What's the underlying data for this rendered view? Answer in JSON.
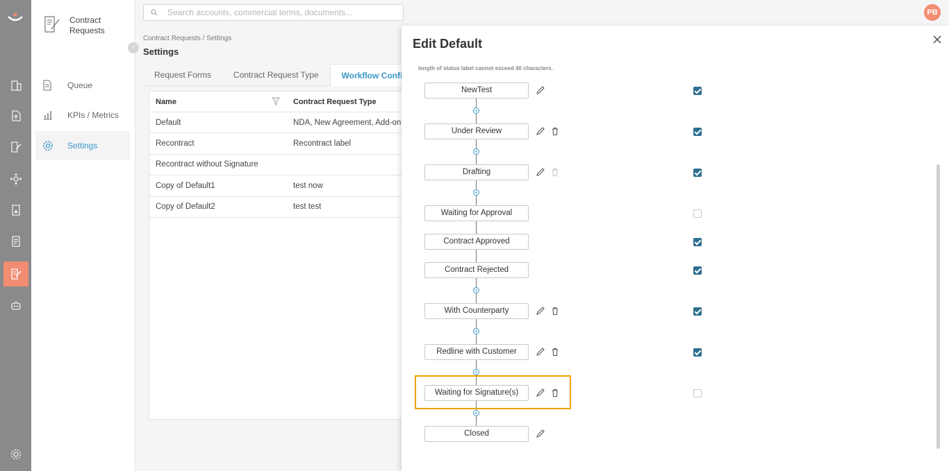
{
  "colors": {
    "accent": "#3a96c8",
    "brand": "#f28c73",
    "rail": "#8a8a8a",
    "highlight": "#f0a400"
  },
  "app": {
    "module_title": "Contract Requests",
    "avatar_initials": "PB"
  },
  "search": {
    "placeholder": "Search accounts, commercial terms, documents..."
  },
  "sidebar": {
    "items": [
      {
        "label": "Queue",
        "icon": "document-icon"
      },
      {
        "label": "KPIs / Metrics",
        "icon": "chart-icon"
      },
      {
        "label": "Settings",
        "icon": "gear-icon",
        "active": true
      }
    ]
  },
  "rail": {
    "icons": [
      "buildings-icon",
      "upload-doc-icon",
      "edit-doc-icon",
      "network-icon",
      "image-doc-icon",
      "file-doc-icon",
      "contract-request-icon",
      "robot-icon",
      "settings-icon"
    ]
  },
  "page": {
    "breadcrumb": "Contract Requests / Settings",
    "title": "Settings",
    "tabs": [
      "Request Forms",
      "Contract Request Type",
      "Workflow Configurat"
    ]
  },
  "table": {
    "headers": [
      "Name",
      "Contract Request Type"
    ],
    "rows": [
      [
        "Default",
        "NDA, New Agreement, Add-on, Re"
      ],
      [
        "Recontract",
        "Recontract label"
      ],
      [
        "Recontract without Signature",
        ""
      ],
      [
        "Copy of Default1",
        "test now"
      ],
      [
        "Copy of Default2",
        "test test"
      ]
    ]
  },
  "panel": {
    "title": "Edit Default",
    "note": "length of status label cannot exceed 40 characters.",
    "stages": [
      {
        "label": "NewTest",
        "edit": true,
        "delete": false,
        "checked": true
      },
      {
        "label": "Under Review",
        "edit": true,
        "delete": true,
        "checked": true
      },
      {
        "label": "Drafting",
        "edit": true,
        "delete": "disabled",
        "checked": true
      },
      {
        "label": "Waiting for Approval",
        "edit": false,
        "delete": false,
        "checked": false
      },
      {
        "label": "Contract Approved",
        "edit": false,
        "delete": false,
        "checked": true
      },
      {
        "label": "Contract Rejected",
        "edit": false,
        "delete": false,
        "checked": true
      },
      {
        "label": "With Counterparty",
        "edit": true,
        "delete": true,
        "checked": true
      },
      {
        "label": "Redline with Customer",
        "edit": true,
        "delete": true,
        "checked": true
      },
      {
        "label": "Waiting for Signature(s)",
        "edit": true,
        "delete": true,
        "checked": false,
        "highlighted": true
      },
      {
        "label": "Closed",
        "edit": true,
        "delete": false,
        "checked": null
      }
    ]
  }
}
